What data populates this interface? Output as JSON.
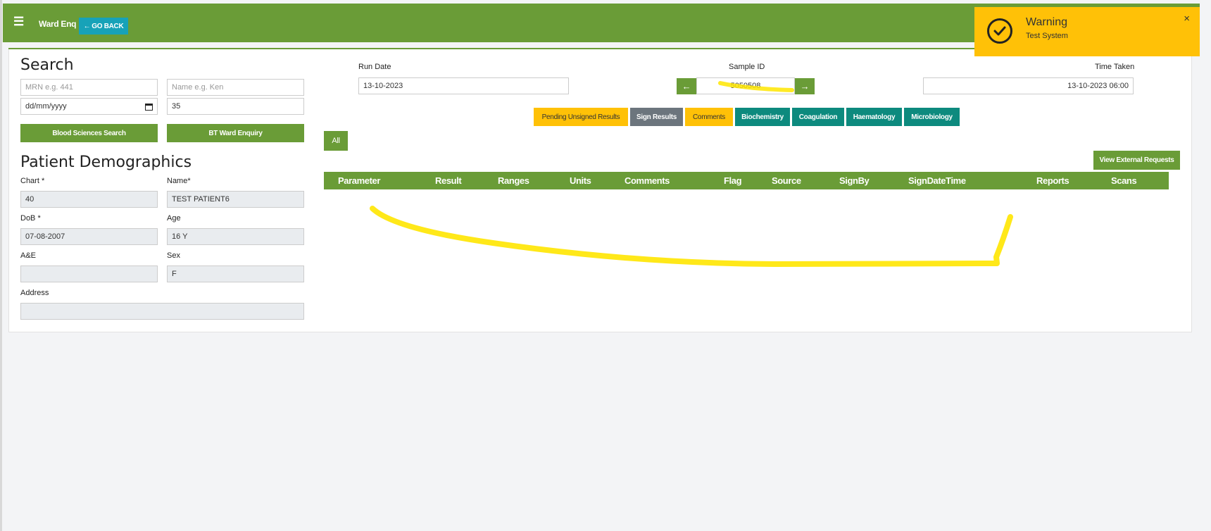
{
  "header": {
    "menu_icon": "☰",
    "title": "Ward Enq",
    "back_label": "GO BACK"
  },
  "search": {
    "heading": "Search",
    "mrn_placeholder": "MRN e.g. 441",
    "name_placeholder": "Name e.g. Ken",
    "date_value": "dd/mm/yyyy",
    "number_value": "35",
    "blood_btn": "Blood Sciences Search",
    "bt_btn": "BT Ward Enquiry"
  },
  "demographics": {
    "heading": "Patient Demographics",
    "chart_label": "Chart *",
    "chart_value": "40",
    "name_label": "Name*",
    "name_value": "TEST PATIENT6",
    "dob_label": "DoB *",
    "dob_value": "07-08-2007",
    "age_label": "Age",
    "age_value": "16 Y",
    "ae_label": "A&E",
    "ae_value": "",
    "sex_label": "Sex",
    "sex_value": "F",
    "address_label": "Address",
    "address_value": ""
  },
  "run": {
    "run_date_label": "Run Date",
    "run_date_value": "13-10-2023",
    "sample_label": "Sample ID",
    "sample_value": "5050508",
    "time_label": "Time Taken",
    "time_value": "13-10-2023 06:00"
  },
  "tabs": [
    {
      "label": "Pending Unsigned Results",
      "color": "#ffc107"
    },
    {
      "label": "Sign Results",
      "color": "#6c757d"
    },
    {
      "label": "Comments",
      "color": "#ffc107"
    },
    {
      "label": "Biochemistry",
      "color": "#0d8a7e"
    },
    {
      "label": "Coagulation",
      "color": "#0d8a7e"
    },
    {
      "label": "Haematology",
      "color": "#0d8a7e"
    },
    {
      "label": "Microbiology",
      "color": "#0d8a7e"
    }
  ],
  "all_btn": "All",
  "view_external": "View External Requests",
  "table_headers": [
    "Parameter",
    "Result",
    "Ranges",
    "Units",
    "Comments",
    "Flag",
    "Source",
    "SignBy",
    "SignDateTime",
    "Reports",
    "Scans"
  ],
  "toast": {
    "title": "Warning",
    "message": "Test System",
    "close": "×",
    "icon": "check-circle-icon"
  },
  "colors": {
    "primary": "#6a9c37",
    "teal": "#17a2b8",
    "warning": "#ffc107"
  }
}
